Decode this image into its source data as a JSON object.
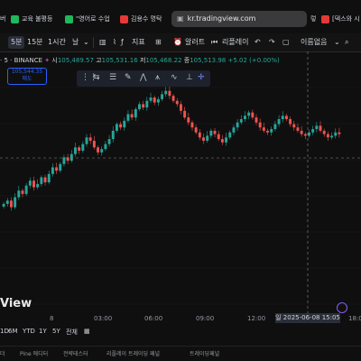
{
  "browser": {
    "tabs": [
      {
        "label": "교육 불평등",
        "favicon": "green"
      },
      {
        "label": "\"영어로 수업",
        "favicon": "green"
      },
      {
        "label": "김용수 명탁",
        "favicon": "red"
      },
      {
        "label": "[덱스와 시",
        "favicon": "red"
      }
    ],
    "partial_left_tab": "버",
    "partial_right_tab": "렇",
    "address": "kr.tradingview.com"
  },
  "toolbar": {
    "interval_selected": "5분",
    "interval_15": "15분",
    "interval_1h": "1시간",
    "more_label": "날",
    "indicators_label": "지표",
    "alert_label": "알러트",
    "replay_label": "리플레이",
    "layout_name": "이름없음"
  },
  "symbol": {
    "name": "· 5 · BINANCE",
    "o_label": "시",
    "o": "105,489.57",
    "h_label": "고",
    "h": "105,531.16",
    "l_label": "저",
    "l": "105,468.22",
    "c_label": "종",
    "c": "105,513.98",
    "change": "+5.02 (+0.00%)",
    "price_box": "105,544.35",
    "price_box_sub": "매도"
  },
  "time_axis": [
    "8",
    "03:00",
    "06:00",
    "09:00",
    "12:00",
    "18:00"
  ],
  "crosshair_date": "일 2025-06-08  15:05",
  "watermark": "View",
  "ranges": [
    "1D",
    "6M",
    "YTD",
    "1Y",
    "5Y",
    "전체"
  ],
  "bottom_tabs": [
    "더",
    "Pine 에디터",
    "전략테스터",
    "리플레이 트레이딩 패널",
    "트레이딩패널"
  ],
  "colors": {
    "up": "#26a69a",
    "down": "#ef5350",
    "accent": "#2962ff"
  },
  "chart_data": {
    "type": "candlestick",
    "closes": [
      105300,
      105310,
      105290,
      105320,
      105340,
      105330,
      105355,
      105370,
      105350,
      105360,
      105380,
      105365,
      105390,
      105410,
      105400,
      105420,
      105440,
      105430,
      105450,
      105470,
      105460,
      105480,
      105500,
      105490,
      105470,
      105455,
      105465,
      105480,
      105495,
      105520,
      105540,
      105530,
      105550,
      105570,
      105560,
      105585,
      105600,
      105590,
      105610,
      105620,
      105605,
      105615,
      105630,
      105640,
      105625,
      105610,
      105600,
      105580,
      105560,
      105545,
      105530,
      105515,
      105500,
      105490,
      105505,
      105520,
      105510,
      105495,
      105485,
      105500,
      105515,
      105530,
      105545,
      105555,
      105565,
      105575,
      105560,
      105545,
      105530,
      105520,
      105515,
      105525,
      105540,
      105555,
      105565,
      105555,
      105540,
      105530,
      105520,
      105510,
      105505,
      105515,
      105525,
      105535,
      105520,
      105510,
      105500,
      105505,
      105515,
      105510
    ]
  }
}
